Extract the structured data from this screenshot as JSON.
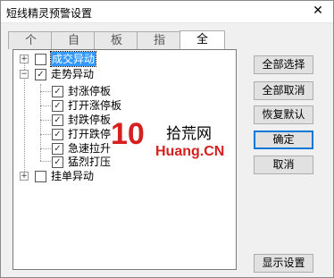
{
  "window": {
    "title": "短线精灵预警设置",
    "close_glyph": "✕"
  },
  "tabs": [
    {
      "label": "个"
    },
    {
      "label": "自"
    },
    {
      "label": "板"
    },
    {
      "label": "指"
    },
    {
      "label": "全",
      "active": true
    }
  ],
  "tree": {
    "item0": {
      "label": "成交异动",
      "expanded": false,
      "checked": false,
      "selected": true
    },
    "item1": {
      "label": "走势异动",
      "expanded": true,
      "checked": true,
      "children": [
        {
          "label": "封涨停板",
          "checked": true
        },
        {
          "label": "打开涨停板",
          "checked": true
        },
        {
          "label": "封跌停板",
          "checked": true
        },
        {
          "label": "打开跌停",
          "checked": true
        },
        {
          "label": "急速拉升",
          "checked": true
        },
        {
          "label": "猛烈打压",
          "checked": true
        }
      ]
    },
    "item2": {
      "label": "挂单异动",
      "expanded": false,
      "checked": false
    }
  },
  "glyphs": {
    "plus": "+",
    "minus": "−",
    "check": "✓"
  },
  "buttons": {
    "select_all": "全部选择",
    "cancel_all": "全部取消",
    "restore_default": "恢复默认",
    "ok": "确定",
    "cancel": "取消",
    "display_settings": "显示设置"
  },
  "watermark": {
    "logo": "10",
    "top": "拾荒网",
    "bottom": "Huang.CN"
  }
}
